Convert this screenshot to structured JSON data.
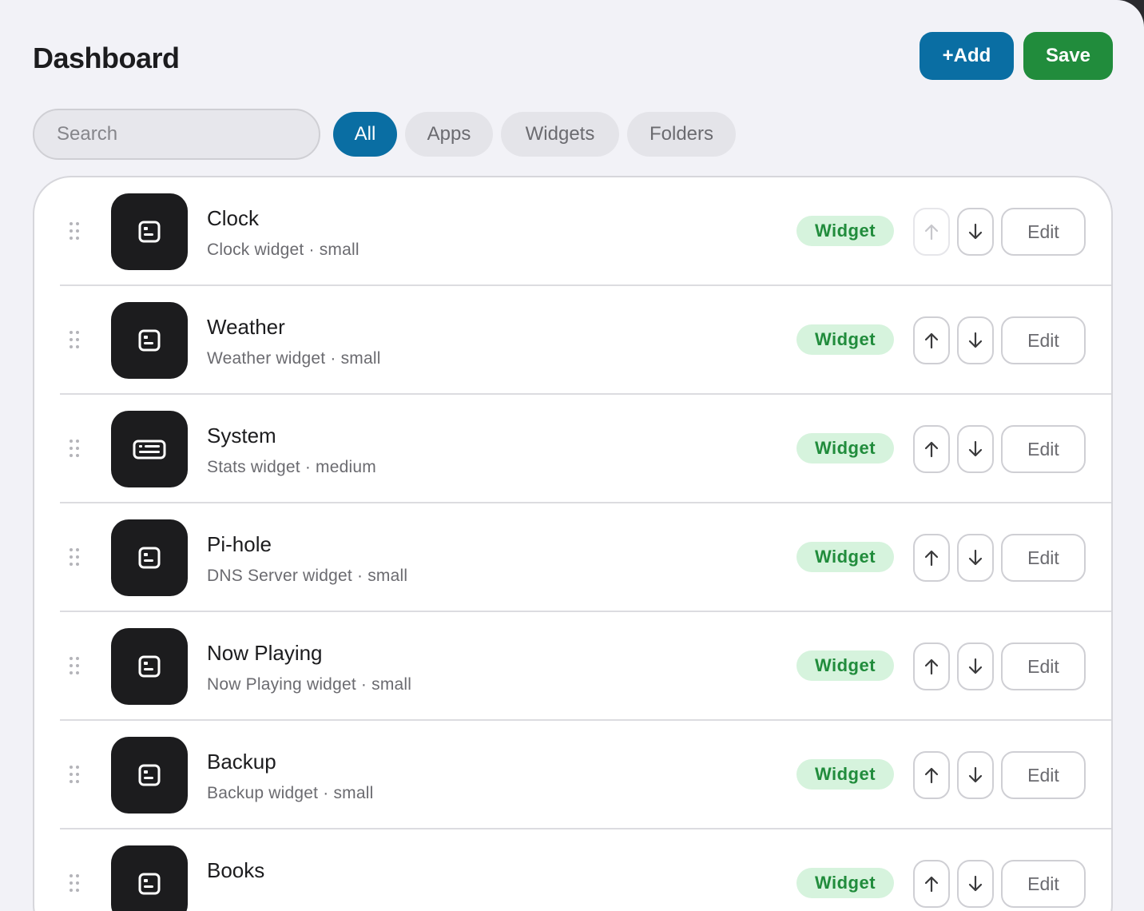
{
  "header": {
    "title": "Dashboard",
    "add_label": "+Add",
    "save_label": "Save"
  },
  "filters": {
    "search_placeholder": "Search",
    "search_value": "",
    "pills": [
      {
        "label": "All",
        "active": true
      },
      {
        "label": "Apps",
        "active": false
      },
      {
        "label": "Widgets",
        "active": false
      },
      {
        "label": "Folders",
        "active": false
      }
    ]
  },
  "colors": {
    "accent": "#0a6ea3",
    "save": "#218c3c",
    "badge_bg": "#d6f3dd",
    "badge_text": "#218c3c",
    "icon_tile": "#1c1c1e"
  },
  "items": [
    {
      "name": "Clock",
      "description": "Clock widget · small",
      "badge": "Widget",
      "icon": "small-widget-icon",
      "up_disabled": true,
      "edit_label": "Edit"
    },
    {
      "name": "Weather",
      "description": "Weather widget · small",
      "badge": "Widget",
      "icon": "small-widget-icon",
      "up_disabled": false,
      "edit_label": "Edit"
    },
    {
      "name": "System",
      "description": "Stats widget · medium",
      "badge": "Widget",
      "icon": "medium-widget-icon",
      "up_disabled": false,
      "edit_label": "Edit"
    },
    {
      "name": "Pi-hole",
      "description": "DNS Server widget · small",
      "badge": "Widget",
      "icon": "small-widget-icon",
      "up_disabled": false,
      "edit_label": "Edit"
    },
    {
      "name": "Now Playing",
      "description": "Now Playing widget · small",
      "badge": "Widget",
      "icon": "small-widget-icon",
      "up_disabled": false,
      "edit_label": "Edit"
    },
    {
      "name": "Backup",
      "description": "Backup widget · small",
      "badge": "Widget",
      "icon": "small-widget-icon",
      "up_disabled": false,
      "edit_label": "Edit"
    },
    {
      "name": "Books",
      "description": "",
      "badge": "Widget",
      "icon": "small-widget-icon",
      "up_disabled": false,
      "edit_label": "Edit"
    }
  ]
}
